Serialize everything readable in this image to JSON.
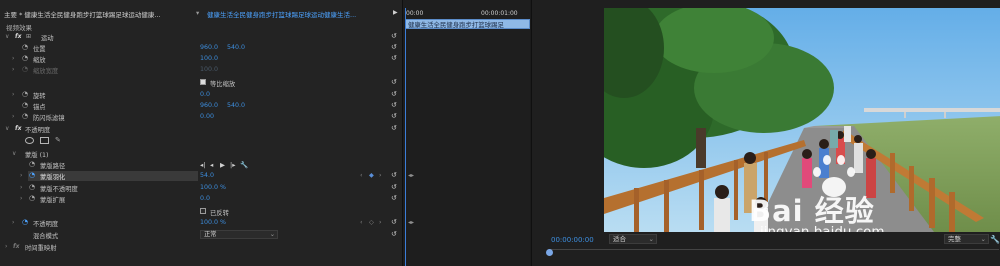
{
  "header": {
    "source": "主要 * 健康生活全民健身跑步打篮球踢足球运动健康...",
    "dropdown_arrow": "▾",
    "clip": "健康生活全民健身跑步打篮球踢足球运动健康生活...",
    "play": "▶"
  },
  "section_label": "视频效果",
  "effects": {
    "motion": {
      "label": "运动"
    },
    "position": {
      "label": "位置",
      "x": "960.0",
      "y": "540.0"
    },
    "scale": {
      "label": "缩放",
      "value": "100.0"
    },
    "scale_width": {
      "label": "缩放宽度",
      "value": "100.0"
    },
    "uniform_scale": {
      "label": "等比缩放"
    },
    "rotation": {
      "label": "旋转",
      "value": "0.0"
    },
    "anchor": {
      "label": "锚点",
      "x": "960.0",
      "y": "540.0"
    },
    "anti_flicker": {
      "label": "防闪烁滤镜",
      "value": "0.00"
    },
    "opacity_group": {
      "label": "不透明度"
    },
    "mask": {
      "label": "蒙版 (1)"
    },
    "mask_path": {
      "label": "蒙版路径"
    },
    "mask_feather": {
      "label": "蒙版羽化",
      "value": "54.0"
    },
    "mask_opacity": {
      "label": "蒙版不透明度",
      "value": "100.0 %"
    },
    "mask_expansion": {
      "label": "蒙版扩展",
      "value": "0.0"
    },
    "inverted": {
      "label": "已反转"
    },
    "opacity": {
      "label": "不透明度",
      "value": "100.0 %"
    },
    "blend_mode": {
      "label": "混合模式",
      "value": "正常"
    },
    "time_remap": {
      "label": "时间重映射"
    }
  },
  "timeline": {
    "t_start": "00:00",
    "t_end": "00:00:01:00",
    "clip": "健康生活全民健身跑步打篮球踢足"
  },
  "program": {
    "timecode": "00:00:00:00",
    "fit": "适合",
    "quality": "完整",
    "watermark_main": "Bai 经验",
    "watermark_sub": "jingyan.baidu.com"
  },
  "colors": {
    "value_blue": "#3d8fe0",
    "clip_blue": "#8fb9e6",
    "playhead": "#3b7dd8"
  }
}
